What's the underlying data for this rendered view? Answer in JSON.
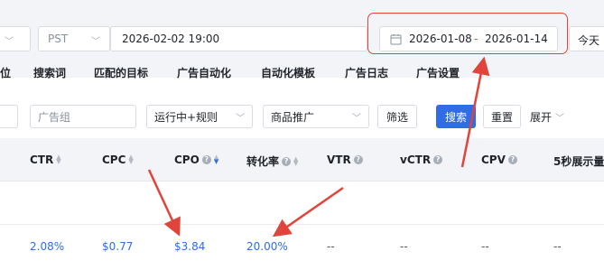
{
  "topbar": {
    "timezone": "PST",
    "datetime": "2026-02-02 19:00",
    "date_start": "2026-01-08",
    "date_sep": "-",
    "date_end": "2026-01-14",
    "today": "今天"
  },
  "nav": {
    "items": [
      "位",
      "搜索词",
      "匹配的目标",
      "广告自动化",
      "自动化模板",
      "广告日志",
      "广告设置"
    ]
  },
  "filters": {
    "ad_group_placeholder": "广告组",
    "status_value": "运行中+规则",
    "type_value": "商品推广",
    "filter_label": "筛选",
    "search_label": "搜索",
    "reset_label": "重置",
    "expand_label": "展开"
  },
  "table": {
    "headers": [
      "CTR",
      "CPC",
      "CPO",
      "转化率",
      "VTR",
      "vCTR",
      "CPV",
      "5秒展示量"
    ],
    "row": [
      "2.08%",
      "$0.77",
      "$3.84",
      "20.00%",
      "--",
      "--",
      "--",
      "--"
    ]
  },
  "colors": {
    "accent": "#2f6ce5",
    "annotation": "#e0443a"
  }
}
